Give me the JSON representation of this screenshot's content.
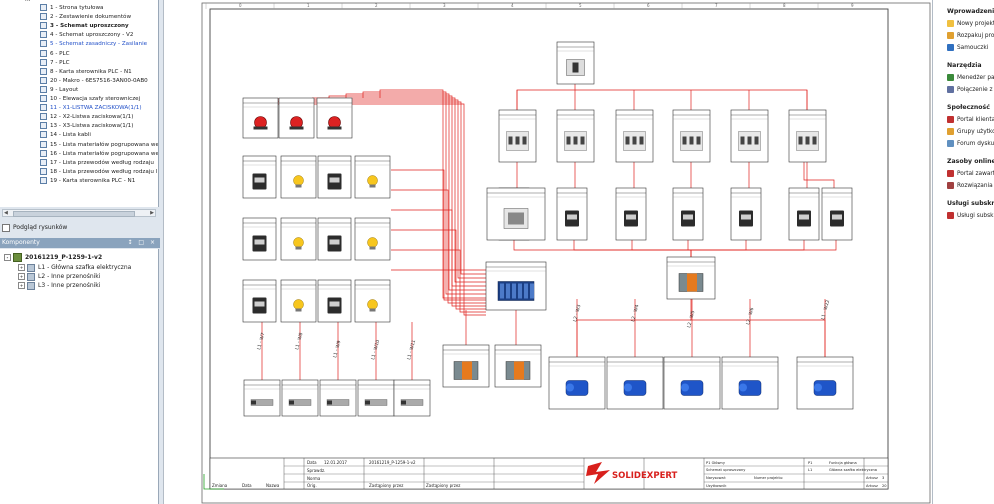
{
  "tree": {
    "items": [
      {
        "label": "1 - Strona tytułowa",
        "style": ""
      },
      {
        "label": "2 - Zestawienie dokumentów",
        "style": ""
      },
      {
        "label": "3 - Schemat uproszczony",
        "style": "bold"
      },
      {
        "label": "4 - Schemat uproszczony - V2",
        "style": ""
      },
      {
        "label": "5 - Schemat zasadniczy - Zasilanie",
        "style": "blue"
      },
      {
        "label": "6 - PLC",
        "style": ""
      },
      {
        "label": "7 - PLC",
        "style": ""
      },
      {
        "label": "8 - Karta sterownika PLC - N1",
        "style": ""
      },
      {
        "label": "20 - Makro - 6ES7516-3AN00-0AB0",
        "style": ""
      },
      {
        "label": "9 - Layout",
        "style": ""
      },
      {
        "label": "10 - Elewacja szafy sterowniczej",
        "style": ""
      },
      {
        "label": "11 - X1-LISTWA ZACISKOWA(1/1)",
        "style": "blue"
      },
      {
        "label": "12 - X2-Listwa zaciskowa(1/1)",
        "style": ""
      },
      {
        "label": "13 - X3-Listwa zaciskowa(1/1)",
        "style": ""
      },
      {
        "label": "14 - Lista kabli",
        "style": ""
      },
      {
        "label": "15 - Lista materiałów pogrupowana według",
        "style": ""
      },
      {
        "label": "16 - Lista materiałów pogrupowana według",
        "style": ""
      },
      {
        "label": "17 - Lista przewodów według rodzaju",
        "style": ""
      },
      {
        "label": "18 - Lista przewodów według rodzaju l",
        "style": ""
      },
      {
        "label": "19 - Karta sterownika PLC - N1",
        "style": ""
      }
    ]
  },
  "preview": {
    "label": "Podgląd rysunków"
  },
  "components": {
    "title": "Komponenty",
    "controls": "↕ □ ×",
    "root": "20161219_P-1259-1-v2",
    "items": [
      "L1 - Główna szafka elektryczna",
      "L2 - Inne przenośniki",
      "L3 - Inne przenośniki"
    ]
  },
  "drawing": {
    "column_numbers": [
      "0",
      "1",
      "2",
      "3",
      "4",
      "5",
      "6",
      "7",
      "8",
      "9"
    ],
    "wire_labels": [
      "L1 - W7",
      "L1 - W8",
      "L1 - W9",
      "L1 - W10",
      "L1 - W11",
      "L2 - W3",
      "L2 - W4",
      "L2 - W5",
      "L2 - W6",
      "L1 - W22"
    ],
    "title_block": {
      "logo_text": "SOLIDEXPERT",
      "date_label": "Data",
      "date_value": "12.01.2017",
      "file_value": "20161219_P-1259-1-v2",
      "row_labels": [
        "Data",
        "Sprawdz.",
        "Norma"
      ],
      "bottom_labels": [
        "Zmiana",
        "Data",
        "Nazwa",
        "Orig.",
        "Zastąpiony przez",
        "Zastąpiony przez"
      ],
      "doc_title_1": "P1 Główny",
      "doc_title_2": "Schemat uproszczony",
      "created_by": "Narysował:",
      "author": "Uzytkownik",
      "project_label": "Numer projektu:",
      "sheet_label_1": "P1",
      "sheet_label_2": "L1",
      "sheet_desc_1": "Funkcja główna",
      "sheet_desc_2": "Główna szafka elektryczna",
      "arkusz_label": "Arkusz",
      "arkusz_value": "3",
      "arkusz_total_label": "Arkusz",
      "arkusz_total": "20"
    }
  },
  "right_panel": {
    "sections": [
      {
        "title": "Wprowadzenie",
        "items": [
          {
            "label": "Nowy projekt",
            "color": "#f0c040"
          },
          {
            "label": "Rozpakuj projekt",
            "color": "#e0a030"
          },
          {
            "label": "Samouczki",
            "color": "#3070c0"
          }
        ]
      },
      {
        "title": "Narzędzia",
        "items": [
          {
            "label": "Menedżer pakietów",
            "color": "#3a8a3a"
          },
          {
            "label": "Połączenie z ERP",
            "color": "#6070a0"
          }
        ]
      },
      {
        "title": "Społeczność",
        "items": [
          {
            "label": "Portal klienta",
            "color": "#c03030"
          },
          {
            "label": "Grupy użytkowników",
            "color": "#e0a030"
          },
          {
            "label": "Forum dyskusyjne",
            "color": "#6090c0"
          }
        ]
      },
      {
        "title": "Zasoby online",
        "items": [
          {
            "label": "Portal zawartości",
            "color": "#c03030"
          },
          {
            "label": "Rozwiązania partnerów",
            "color": "#a04040"
          }
        ]
      },
      {
        "title": "Usługi subskrypcyjne",
        "items": [
          {
            "label": "Usługi subskrypcyjne",
            "color": "#c03030"
          }
        ]
      }
    ]
  },
  "colors": {
    "wire": "#e0201c",
    "frame": "#444444",
    "accent_blue": "#2250c8"
  }
}
